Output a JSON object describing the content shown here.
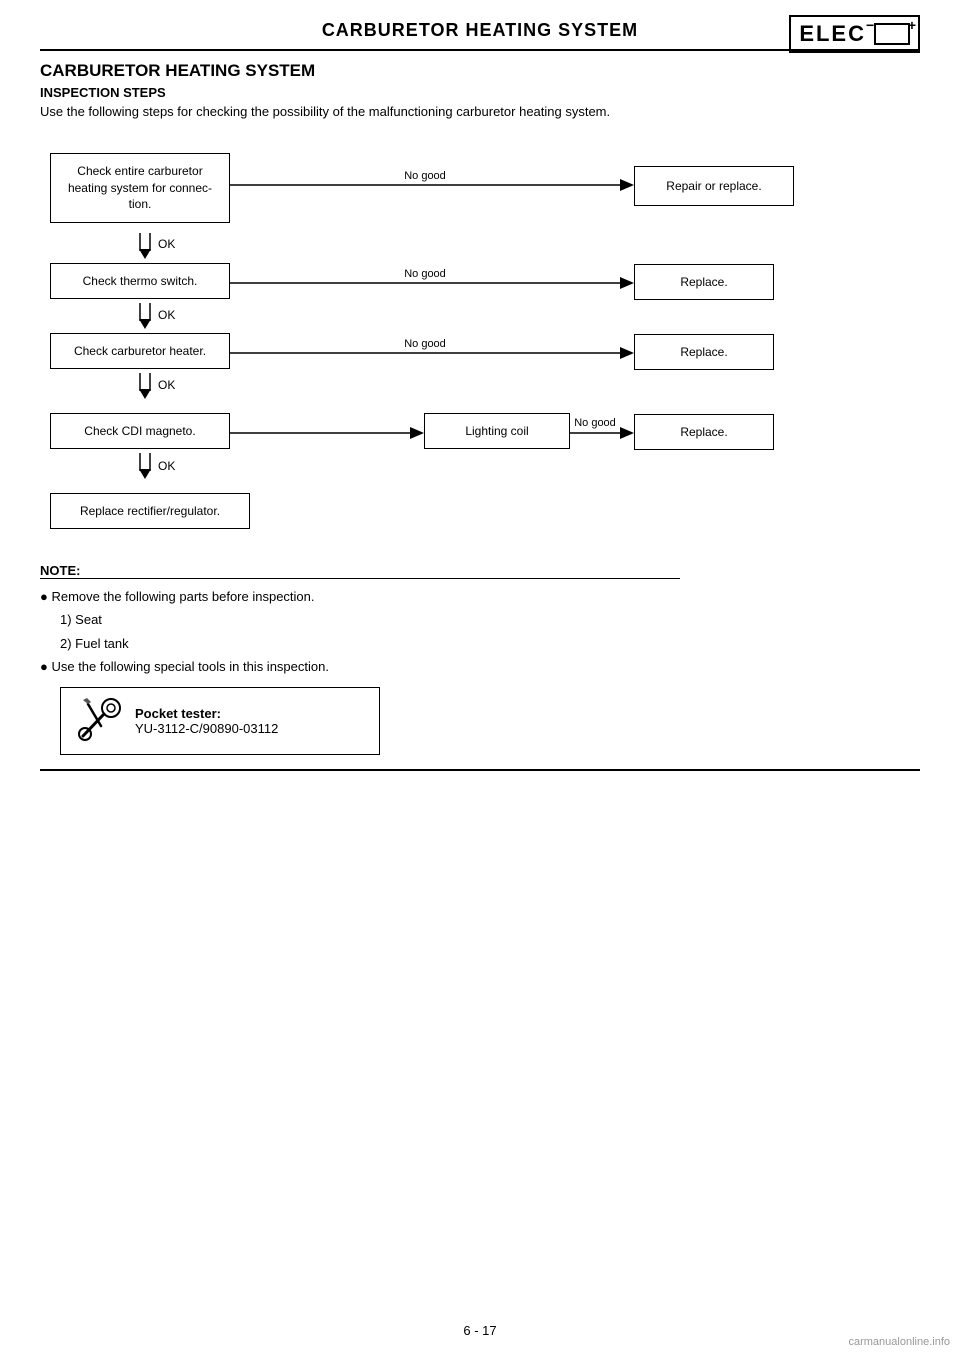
{
  "header": {
    "title": "CARBURETOR HEATING SYSTEM",
    "badge": "ELEC"
  },
  "section": {
    "title": "CARBURETOR HEATING SYSTEM",
    "subsection": "INSPECTION STEPS",
    "intro": "Use the following steps for checking the possibility of the malfunctioning carburetor heating system."
  },
  "flowchart": {
    "steps": [
      {
        "id": "step1",
        "text": "Check entire carburetor heating system for connec-tion."
      },
      {
        "id": "step2",
        "text": "Check thermo switch."
      },
      {
        "id": "step3",
        "text": "Check carburetor heater."
      },
      {
        "id": "step4",
        "text": "Check CDI magneto."
      },
      {
        "id": "step5",
        "text": "Lighting coil"
      },
      {
        "id": "step6",
        "text": "Replace rectifier/regulator."
      }
    ],
    "outcomes": [
      {
        "id": "out1",
        "text": "Repair or replace."
      },
      {
        "id": "out2",
        "text": "Replace."
      },
      {
        "id": "out3",
        "text": "Replace."
      },
      {
        "id": "out4",
        "text": "Replace."
      }
    ],
    "labels": {
      "no_good": "No good",
      "ok": "OK"
    }
  },
  "note": {
    "title": "NOTE:",
    "bullets": [
      "Remove the following parts before inspection.",
      "Use the following special tools in this inspection."
    ],
    "sub_items": [
      "1)  Seat",
      "2)  Fuel tank"
    ]
  },
  "tool": {
    "label": "Pocket tester:",
    "code": "YU-3112-C/90890-03112"
  },
  "page_number": "6 - 17",
  "watermark": "carmanualonline.info"
}
